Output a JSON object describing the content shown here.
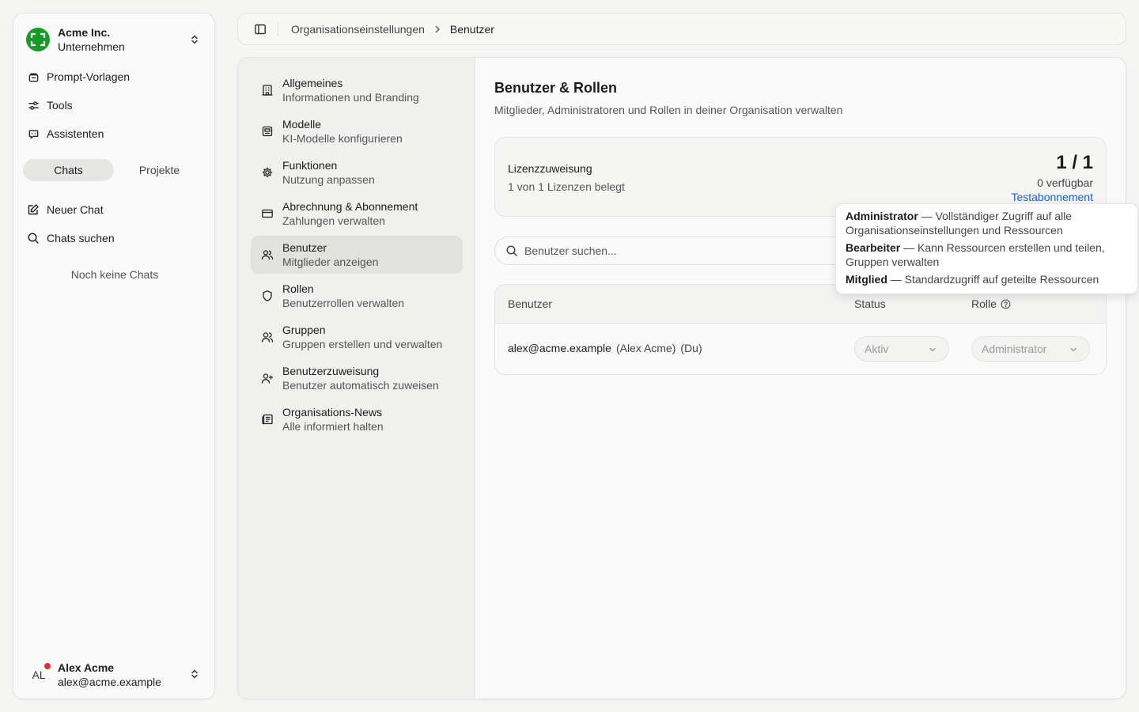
{
  "sidebar": {
    "org": {
      "name": "Acme Inc.",
      "type": "Unternehmen",
      "icon": "org-logo-icon",
      "logo_color": "#1a9a2a"
    },
    "nav": [
      {
        "label": "Prompt-Vorlagen",
        "icon": "prompt-template-icon"
      },
      {
        "label": "Tools",
        "icon": "tools-sliders-icon"
      },
      {
        "label": "Assistenten",
        "icon": "assistant-icon"
      }
    ],
    "tabs": {
      "chats": "Chats",
      "projects": "Projekte",
      "active": "chats"
    },
    "actions": [
      {
        "label": "Neuer Chat",
        "icon": "new-chat-icon"
      },
      {
        "label": "Chats suchen",
        "icon": "search-icon"
      }
    ],
    "empty_text": "Noch keine Chats",
    "user": {
      "initials": "AL",
      "name": "Alex Acme",
      "email": "alex@acme.example",
      "status_color": "#e03131"
    }
  },
  "breadcrumb": {
    "items": [
      "Organisationseinstellungen",
      "Benutzer"
    ]
  },
  "settings_nav": [
    {
      "title": "Allgemeines",
      "subtitle": "Informationen und Branding",
      "icon": "building-icon"
    },
    {
      "title": "Modelle",
      "subtitle": "KI-Modelle konfigurieren",
      "icon": "model-icon"
    },
    {
      "title": "Funktionen",
      "subtitle": "Nutzung anpassen",
      "icon": "gear-icon"
    },
    {
      "title": "Abrechnung & Abonnement",
      "subtitle": "Zahlungen verwalten",
      "icon": "credit-card-icon"
    },
    {
      "title": "Benutzer",
      "subtitle": "Mitglieder anzeigen",
      "icon": "users-icon",
      "active": true
    },
    {
      "title": "Rollen",
      "subtitle": "Benutzerrollen verwalten",
      "icon": "shield-icon"
    },
    {
      "title": "Gruppen",
      "subtitle": "Gruppen erstellen und verwalten",
      "icon": "group-icon"
    },
    {
      "title": "Benutzerzuweisung",
      "subtitle": "Benutzer automatisch zuweisen",
      "icon": "user-plus-icon"
    },
    {
      "title": "Organisations-News",
      "subtitle": "Alle informiert halten",
      "icon": "newspaper-icon"
    }
  ],
  "main": {
    "title": "Benutzer & Rollen",
    "description": "Mitglieder, Administratoren und Rollen in deiner Organisation verwalten",
    "license": {
      "label": "Lizenzzuweisung",
      "used_text": "1 von 1 Lizenzen belegt",
      "count": "1 / 1",
      "available": "0 verfügbar",
      "plan_link": "Testabonnement"
    },
    "search": {
      "placeholder": "Benutzer suchen...",
      "value": ""
    },
    "table": {
      "headers": {
        "user": "Benutzer",
        "status": "Status",
        "role": "Rolle"
      },
      "rows": [
        {
          "email": "alex@acme.example",
          "name": "(Alex Acme)",
          "self": "(Du)",
          "status": "Aktiv",
          "role": "Administrator"
        }
      ]
    },
    "role_tooltip": [
      {
        "role": "Administrator",
        "desc": " — Vollständiger Zugriff auf alle Organisationseinstellungen und Ressourcen"
      },
      {
        "role": "Bearbeiter",
        "desc": " — Kann Ressourcen erstellen und teilen, Gruppen verwalten"
      },
      {
        "role": "Mitglied",
        "desc": " — Standardzugriff auf geteilte Ressourcen"
      }
    ]
  },
  "colors": {
    "link": "#1a5fd8",
    "active_nav_bg": "#e1e1e0",
    "accent_green": "#1a9a2a"
  }
}
